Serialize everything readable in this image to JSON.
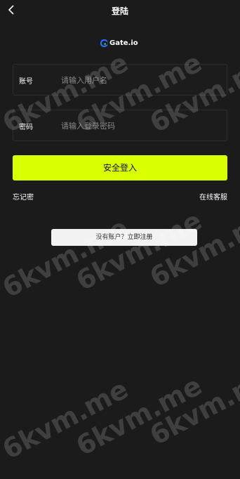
{
  "header": {
    "title": "登陆",
    "back_icon": "chevron-left-icon"
  },
  "logo": {
    "text": "Gate.io"
  },
  "form": {
    "account_label": "账号",
    "account_placeholder": "请输入用户名",
    "password_label": "密码",
    "password_placeholder": "请输入登录密码"
  },
  "actions": {
    "login_label": "安全登入",
    "forgot_label": "忘记密",
    "support_label": "在线客服",
    "register_label": "没有账户？立即注册"
  },
  "watermark": {
    "text": "6kvm.me"
  },
  "colors": {
    "background": "#1b1b1b",
    "accent": "#d9ff00"
  }
}
